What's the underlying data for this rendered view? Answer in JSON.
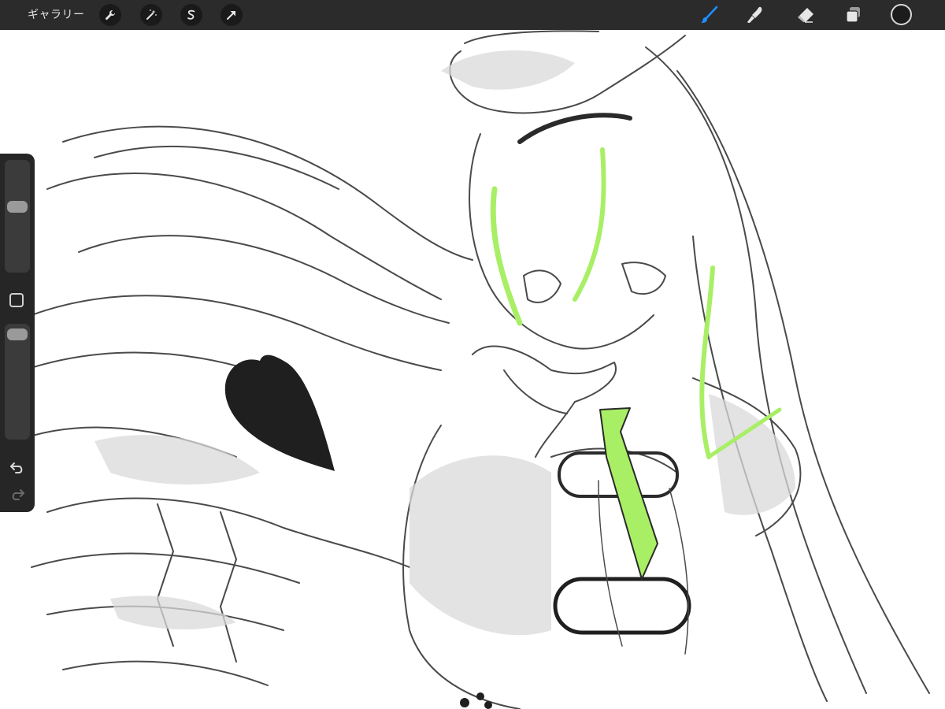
{
  "toolbar": {
    "gallery_label": "ギャラリー",
    "left_tools": [
      "wrench-icon",
      "magic-wand-icon",
      "selection-icon",
      "transform-arrow-icon"
    ],
    "right_tools": [
      "brush-icon",
      "smudge-icon",
      "eraser-icon",
      "layers-icon"
    ],
    "active_tool": "brush-icon",
    "current_color": "#1c1c1c",
    "accent_color": "#1e8eff"
  },
  "sidebar": {
    "brush_size_level": 0.62,
    "opacity_level": 0.95,
    "modify_button": "square-icon",
    "undo": "undo-icon",
    "redo": "redo-icon"
  },
  "canvas": {
    "content": "sketch",
    "highlight_color": "#a8ef66",
    "fill_color": "#1f1f1f"
  }
}
